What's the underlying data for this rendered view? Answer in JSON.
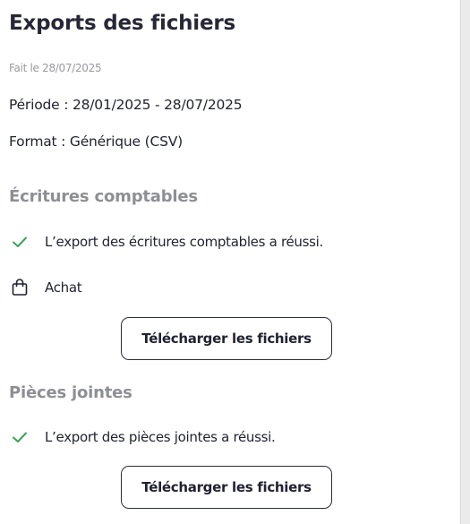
{
  "page": {
    "title": "Exports des fichiers",
    "done_date": "Fait le 28/07/2025",
    "period": "Période : 28/01/2025 - 28/07/2025",
    "format": "Format : Générique (CSV)"
  },
  "sections": [
    {
      "title": "Écritures comptables",
      "status_text": "L’export des écritures comptables a réussi.",
      "journal_label": "Achat",
      "download_label": "Télécharger les fichiers"
    },
    {
      "title": "Pièces jointes",
      "status_text": "L’export des pièces jointes a réussi.",
      "download_label": "Télécharger les fichiers"
    }
  ],
  "icons": {
    "success": "check-icon",
    "journal": "shopping-bag-icon"
  },
  "colors": {
    "success": "#3aa25a",
    "section_title": "#8e8f94",
    "text": "#1f2230"
  }
}
